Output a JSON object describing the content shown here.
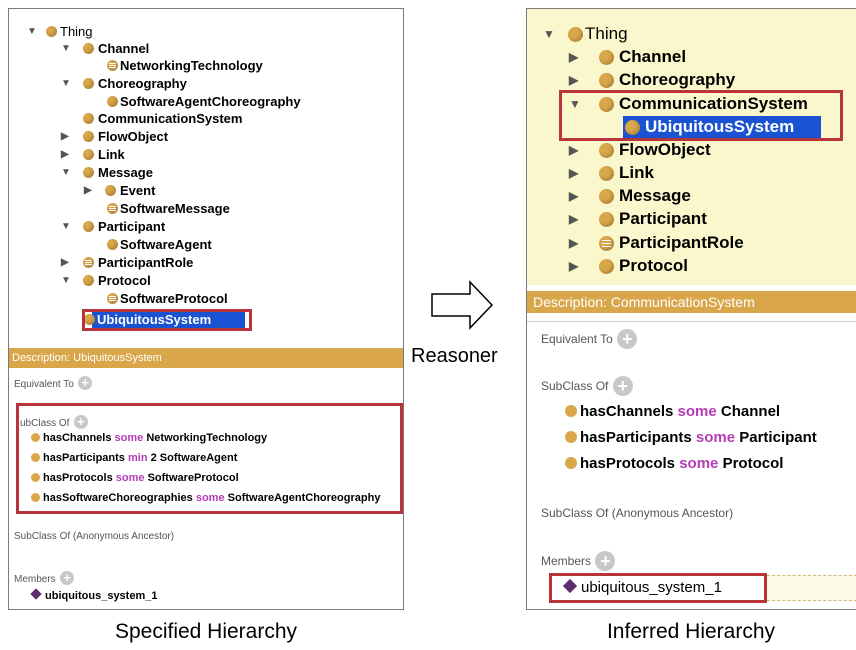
{
  "left": {
    "tree": [
      {
        "label": "Thing",
        "triangle": "open"
      },
      {
        "label": "Channel",
        "triangle": "open"
      },
      {
        "label": "NetworkingTechnology",
        "triangle": "none"
      },
      {
        "label": "Choreography",
        "triangle": "open"
      },
      {
        "label": "SoftwareAgentChoreography",
        "triangle": "none"
      },
      {
        "label": "CommunicationSystem",
        "triangle": "none"
      },
      {
        "label": "FlowObject",
        "triangle": "closed"
      },
      {
        "label": "Link",
        "triangle": "closed"
      },
      {
        "label": "Message",
        "triangle": "open"
      },
      {
        "label": "Event",
        "triangle": "closed"
      },
      {
        "label": "SoftwareMessage",
        "triangle": "none"
      },
      {
        "label": "Participant",
        "triangle": "open"
      },
      {
        "label": "SoftwareAgent",
        "triangle": "none"
      },
      {
        "label": "ParticipantRole",
        "triangle": "closed"
      },
      {
        "label": "Protocol",
        "triangle": "open"
      },
      {
        "label": "SoftwareProtocol",
        "triangle": "none"
      },
      {
        "label": "UbiquitousSystem",
        "triangle": "none"
      }
    ],
    "description_title": "Description: UbiquitousSystem",
    "equivalent_to": "Equivalent To",
    "subclass_of": "ubClass Of",
    "axioms": [
      {
        "prop": "hasChannels",
        "kw": "some",
        "target": "NetworkingTechnology"
      },
      {
        "prop": "hasParticipants",
        "kw": "min",
        "target": "2 SoftwareAgent"
      },
      {
        "prop": "hasProtocols",
        "kw": "some",
        "target": "SoftwareProtocol"
      },
      {
        "prop": "hasSoftwareChoreographies",
        "kw": "some",
        "target": "SoftwareAgentChoreography"
      }
    ],
    "anon_ancestor": "SubClass Of (Anonymous Ancestor)",
    "members": "Members",
    "member_item": "ubiquitous_system_1",
    "caption": "Specified Hierarchy"
  },
  "reasoner_label": "Reasoner",
  "right": {
    "tree": [
      {
        "label": "Thing",
        "triangle": "open"
      },
      {
        "label": "Channel",
        "triangle": "closed"
      },
      {
        "label": "Choreography",
        "triangle": "closed"
      },
      {
        "label": "CommunicationSystem",
        "triangle": "open"
      },
      {
        "label": "UbiquitousSystem",
        "triangle": "none"
      },
      {
        "label": "FlowObject",
        "triangle": "closed"
      },
      {
        "label": "Link",
        "triangle": "closed"
      },
      {
        "label": "Message",
        "triangle": "closed"
      },
      {
        "label": "Participant",
        "triangle": "closed"
      },
      {
        "label": "ParticipantRole",
        "triangle": "closed"
      },
      {
        "label": "Protocol",
        "triangle": "closed"
      }
    ],
    "description_title": "Description: CommunicationSystem",
    "equivalent_to": "Equivalent To",
    "subclass_of": "SubClass Of",
    "axioms": [
      {
        "prop": "hasChannels",
        "kw": "some",
        "target": "Channel"
      },
      {
        "prop": "hasParticipants",
        "kw": "some",
        "target": "Participant"
      },
      {
        "prop": "hasProtocols",
        "kw": "some",
        "target": "Protocol"
      }
    ],
    "anon_ancestor": "SubClass Of (Anonymous Ancestor)",
    "members": "Members",
    "member_item": "ubiquitous_system_1",
    "caption": "Inferred Hierarchy"
  },
  "colors": {
    "class_dot": "#d9a64a",
    "highlight_border": "#b8343a",
    "selection": "#1a53d1",
    "keyword": "#b43db5",
    "inferred_bg": "#fbf7cd"
  }
}
